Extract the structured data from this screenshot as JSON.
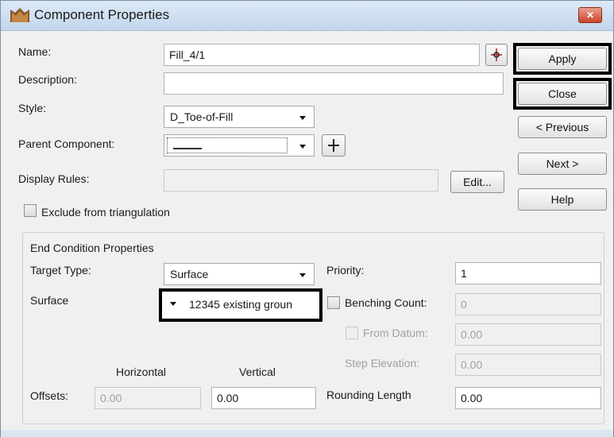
{
  "window": {
    "title": "Component Properties",
    "close_label": "✕"
  },
  "form": {
    "name_label": "Name:",
    "name_value": "Fill_4/1",
    "description_label": "Description:",
    "description_value": "",
    "style_label": "Style:",
    "style_value": "D_Toe-of-Fill",
    "parent_label": "Parent Component:",
    "parent_value": "",
    "display_rules_label": "Display Rules:",
    "display_rules_value": "",
    "edit_label": "Edit...",
    "exclude_label": "Exclude from triangulation",
    "exclude_checked": false
  },
  "buttons": {
    "apply": "Apply",
    "close": "Close",
    "previous": "< Previous",
    "next": "Next >",
    "help": "Help"
  },
  "end_condition": {
    "group_title": "End Condition Properties",
    "target_type_label": "Target Type:",
    "target_type_value": "Surface",
    "surface_label": "Surface",
    "surface_value": "12345 existing groun",
    "priority_label": "Priority:",
    "priority_value": "1",
    "benching_label": "Benching Count:",
    "benching_value": "0",
    "from_datum_label": "From Datum:",
    "from_datum_value": "0.00",
    "step_elevation_label": "Step Elevation:",
    "step_elevation_value": "0.00",
    "horizontal_label": "Horizontal",
    "vertical_label": "Vertical",
    "offsets_label": "Offsets:",
    "horizontal_value": "0.00",
    "vertical_value": "0.00",
    "rounding_label": "Rounding Length",
    "rounding_value": "0.00"
  },
  "icons": {
    "app": "component-app-icon",
    "pick": "crosshair-pick-icon",
    "add": "plus-icon"
  },
  "colors": {
    "titlebar": "#c3d6ec",
    "close_button": "#c9432b",
    "highlight": "#000000"
  }
}
